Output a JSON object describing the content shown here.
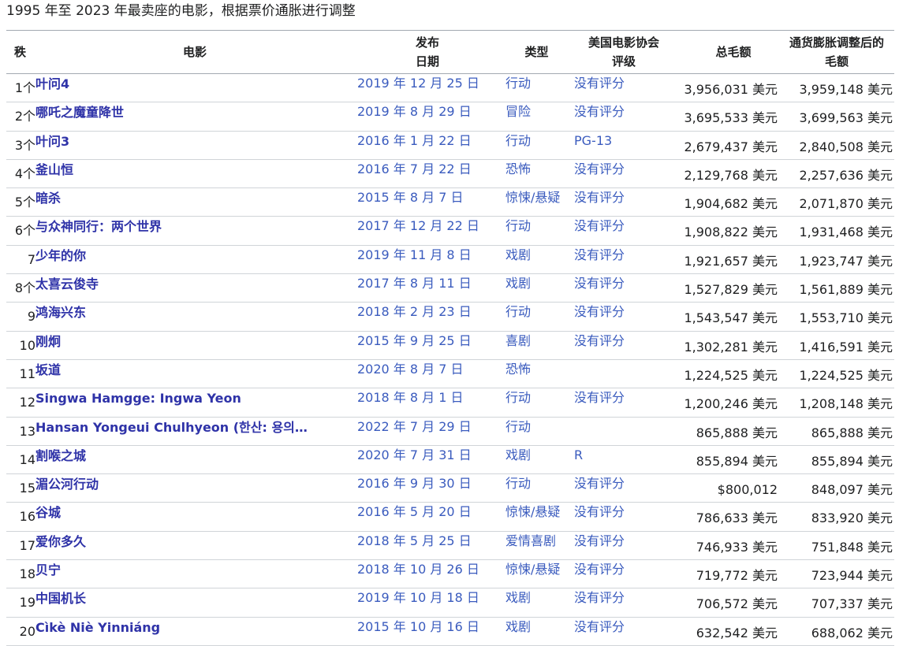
{
  "page": {
    "title": "1995 年至 2023 年最卖座的电影，根据票价通胀进行调整"
  },
  "table": {
    "headers": {
      "rank": "秩",
      "film": "电影",
      "date_line1": "发布",
      "date_line2": "日期",
      "genre": "类型",
      "rating_line1": "美国电影协会",
      "rating_line2": "评级",
      "gross": "总毛额",
      "adjusted_line1": "通货膨胀调整后的",
      "adjusted_line2": "毛额"
    },
    "rows": [
      {
        "rank": "1个",
        "film": "叶问4",
        "date": "2019 年 12 月 25 日",
        "genre": "行动",
        "rating": "没有评分",
        "gross": "3,956,031 美元",
        "adjusted": "3,959,148 美元"
      },
      {
        "rank": "2个",
        "film": "哪吒之魔童降世",
        "date": "2019 年 8 月 29 日",
        "genre": "冒险",
        "rating": "没有评分",
        "gross": "3,695,533 美元",
        "adjusted": "3,699,563 美元"
      },
      {
        "rank": "3个",
        "film": "叶问3",
        "date": "2016 年 1 月 22 日",
        "genre": "行动",
        "rating": "PG-13",
        "gross": "2,679,437 美元",
        "adjusted": "2,840,508 美元"
      },
      {
        "rank": "4个",
        "film": "釜山恒",
        "date": "2016 年 7 月 22 日",
        "genre": "恐怖",
        "rating": "没有评分",
        "gross": "2,129,768 美元",
        "adjusted": "2,257,636 美元"
      },
      {
        "rank": "5个",
        "film": "暗杀",
        "date": "2015 年 8 月 7 日",
        "genre": "惊悚/悬疑",
        "rating": "没有评分",
        "gross": "1,904,682 美元",
        "adjusted": "2,071,870 美元"
      },
      {
        "rank": "6个",
        "film": "与众神同行：两个世界",
        "date": "2017 年 12 月 22 日",
        "genre": "行动",
        "rating": "没有评分",
        "gross": "1,908,822 美元",
        "adjusted": "1,931,468 美元"
      },
      {
        "rank": "7",
        "film": "少年的你",
        "date": "2019 年 11 月 8 日",
        "genre": "戏剧",
        "rating": "没有评分",
        "gross": "1,921,657 美元",
        "adjusted": "1,923,747 美元"
      },
      {
        "rank": "8个",
        "film": "太喜云俊寺",
        "date": "2017 年 8 月 11 日",
        "genre": "戏剧",
        "rating": "没有评分",
        "gross": "1,527,829 美元",
        "adjusted": "1,561,889 美元"
      },
      {
        "rank": "9",
        "film": "鸿海兴东",
        "date": "2018 年 2 月 23 日",
        "genre": "行动",
        "rating": "没有评分",
        "gross": "1,543,547 美元",
        "adjusted": "1,553,710 美元"
      },
      {
        "rank": "10",
        "film": "刚炯",
        "date": "2015 年 9 月 25 日",
        "genre": "喜剧",
        "rating": "没有评分",
        "gross": "1,302,281 美元",
        "adjusted": "1,416,591 美元"
      },
      {
        "rank": "11",
        "film": "坂道",
        "date": "2020 年 8 月 7 日",
        "genre": "恐怖",
        "rating": "",
        "gross": "1,224,525 美元",
        "adjusted": "1,224,525 美元"
      },
      {
        "rank": "12",
        "film": "Singwa Hamgge: Ingwa Yeon",
        "date": "2018 年 8 月 1 日",
        "genre": "行动",
        "rating": "没有评分",
        "gross": "1,200,246 美元",
        "adjusted": "1,208,148 美元"
      },
      {
        "rank": "13",
        "film": "Hansan Yongeui Chulhyeon (한산: 용의…",
        "date": "2022 年 7 月 29 日",
        "genre": "行动",
        "rating": "",
        "gross": "865,888 美元",
        "adjusted": "865,888 美元"
      },
      {
        "rank": "14",
        "film": "割喉之城",
        "date": "2020 年 7 月 31 日",
        "genre": "戏剧",
        "rating": "R",
        "gross": "855,894 美元",
        "adjusted": "855,894 美元"
      },
      {
        "rank": "15",
        "film": "湄公河行动",
        "date": "2016 年 9 月 30 日",
        "genre": "行动",
        "rating": "没有评分",
        "gross": "$800,012",
        "adjusted": "848,097 美元"
      },
      {
        "rank": "16",
        "film": "谷城",
        "date": "2016 年 5 月 20 日",
        "genre": "惊悚/悬疑",
        "rating": "没有评分",
        "gross": "786,633 美元",
        "adjusted": "833,920 美元"
      },
      {
        "rank": "17",
        "film": "爱你多久",
        "date": "2018 年 5 月 25 日",
        "genre": "爱情喜剧",
        "rating": "没有评分",
        "gross": "746,933 美元",
        "adjusted": "751,848 美元"
      },
      {
        "rank": "18",
        "film": "贝宁",
        "date": "2018 年 10 月 26 日",
        "genre": "惊悚/悬疑",
        "rating": "没有评分",
        "gross": "719,772 美元",
        "adjusted": "723,944 美元"
      },
      {
        "rank": "19",
        "film": "中国机长",
        "date": "2019 年 10 月 18 日",
        "genre": "戏剧",
        "rating": "没有评分",
        "gross": "706,572 美元",
        "adjusted": "707,337 美元"
      },
      {
        "rank": "20",
        "film": "Cìkè Niè Yinniáng",
        "date": "2015 年 10 月 16 日",
        "genre": "戏剧",
        "rating": "没有评分",
        "gross": "632,542 美元",
        "adjusted": "688,062 美元"
      }
    ]
  }
}
